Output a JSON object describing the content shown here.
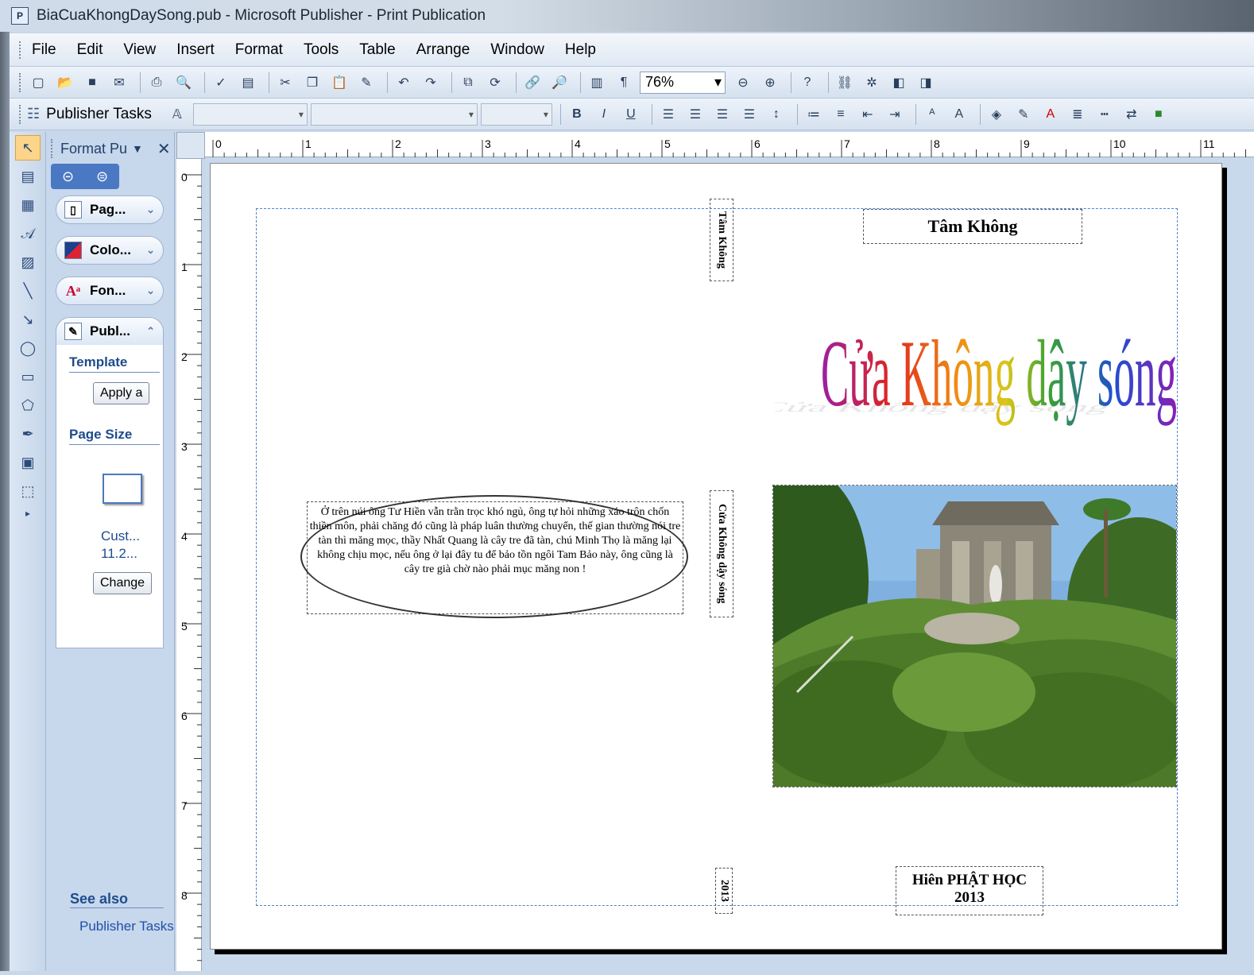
{
  "window": {
    "title": "BiaCuaKhongDaySong.pub - Microsoft Publisher - Print Publication"
  },
  "menu": [
    "File",
    "Edit",
    "View",
    "Insert",
    "Format",
    "Tools",
    "Table",
    "Arrange",
    "Window",
    "Help"
  ],
  "toolbar": {
    "zoom": "76%",
    "tasks_label": "Publisher Tasks"
  },
  "taskpane": {
    "title": "Format Pu",
    "sections": [
      "Pag...",
      "Colo...",
      "Fon...",
      "Publ..."
    ],
    "template_heading": "Template",
    "apply_button": "Apply a",
    "page_size_heading": "Page Size",
    "page_size_name": "Cust...",
    "page_size_dims": "11.2...",
    "change_button": "Change",
    "see_also": "See also",
    "see_also_link": "Publisher Tasks"
  },
  "rulers": {
    "horizontal": [
      "0",
      "1",
      "2",
      "3",
      "4",
      "5",
      "6",
      "7",
      "8",
      "9",
      "10",
      "11"
    ],
    "vertical": [
      "0",
      "1",
      "2",
      "3",
      "4",
      "5",
      "6",
      "7",
      "8"
    ]
  },
  "document": {
    "author_top": "Tâm Không",
    "spine_author": "Tâm Không",
    "spine_title": "Cửa Không dậy sóng",
    "spine_year": "2013",
    "wordart_title": "Cửa Không dậy sóng",
    "oval_text": "Ở trên núi ông Tư Hiền vẫn trằn trọc khó ngủ, ông tự hỏi những xáo trộn chốn thiền môn, phải chăng đó cũng là pháp luân thường chuyển, thế gian thường nói tre tàn thì măng mọc, thầy Nhất Quang là cây tre đã tàn, chú Minh Thọ là măng lại không chịu mọc, nếu ông ở lại đây tu để bảo tồn ngôi Tam Bảo này, ông cũng là cây tre già chờ nào phải mục măng non !",
    "publisher_line1": "Hiên PHẬT HỌC",
    "publisher_line2": "2013"
  },
  "colors": {
    "wordart_gradient": [
      "#9b1fa3",
      "#e0261e",
      "#f28a14",
      "#d9c61a",
      "#3aa234",
      "#1f4fd0",
      "#8a1fb5"
    ]
  }
}
